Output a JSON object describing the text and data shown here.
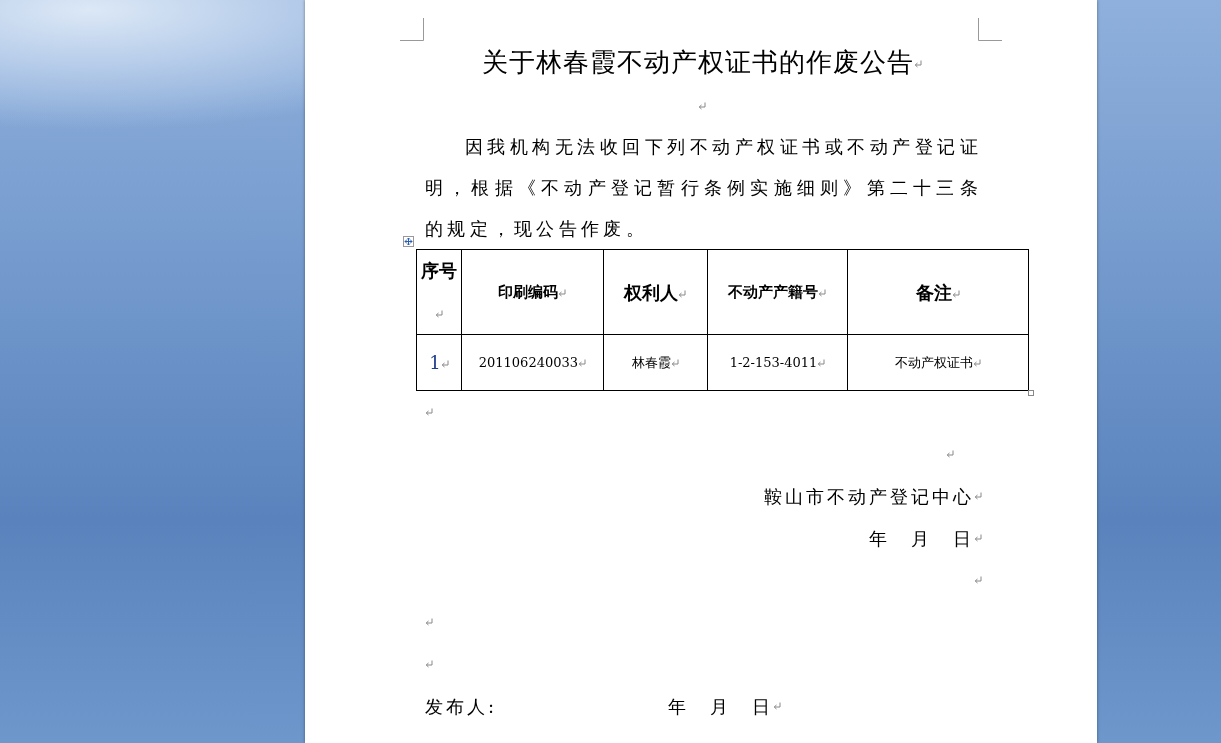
{
  "document": {
    "title": "关于林春霞不动产权证书的作废公告",
    "intro": "因我机构无法收回下列不动产权证书或不动产登记证明，根据《不动产登记暂行条例实施细则》第二十三条的规定，现公告作废。",
    "table": {
      "columns": [
        "序号",
        "印刷编码",
        "权利人",
        "不动产产籍号",
        "备注"
      ],
      "rows": [
        [
          "1",
          "201106240033",
          "林春霞",
          "1-2-153-4011",
          "不动产权证书"
        ]
      ]
    },
    "issuer": "鞍山市不动产登记中心",
    "issuer_date": "年　月　日",
    "publisher_label": "发布人:",
    "publisher_date": "年　月　日"
  }
}
